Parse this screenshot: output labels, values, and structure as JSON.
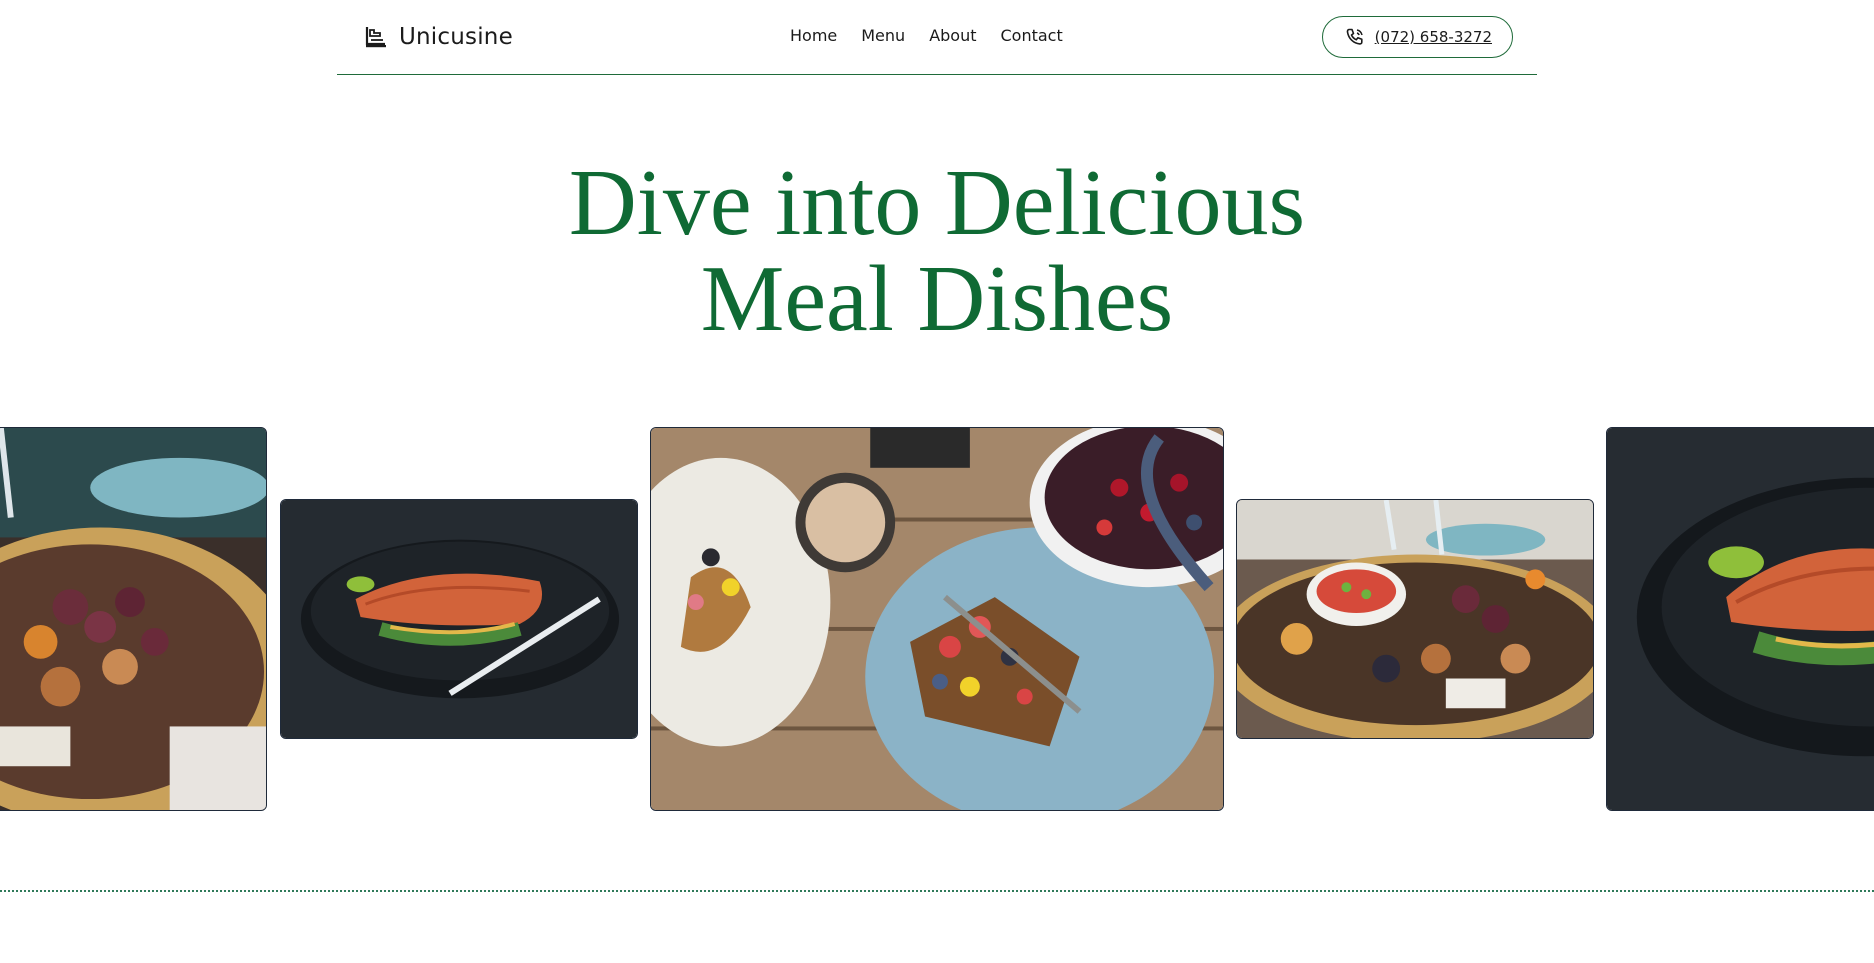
{
  "brand": {
    "name": "Unicusine",
    "icon": "chef-hat-icon"
  },
  "nav": {
    "items": [
      "Home",
      "Menu",
      "About",
      "Contact"
    ]
  },
  "contact": {
    "phone": "(072) 658-3272",
    "icon": "phone-icon"
  },
  "hero": {
    "title_line1": "Dive into Delicious",
    "title_line2": "Meal Dishes"
  },
  "gallery": {
    "images": [
      "charcuterie-platter-image",
      "salmon-plate-image",
      "french-toast-berries-image",
      "charcuterie-board-image",
      "salmon-plate-image"
    ]
  },
  "colors": {
    "accent": "#0f6a34",
    "border": "#1f6b3a",
    "divider": "#2f7a5a"
  }
}
